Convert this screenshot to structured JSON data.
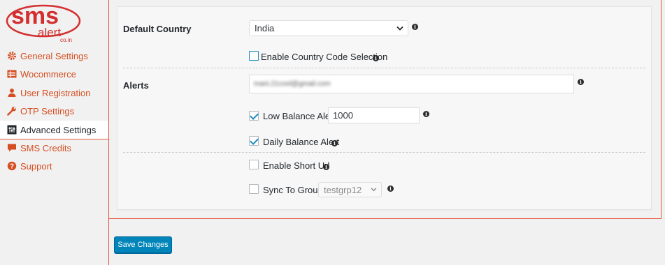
{
  "logo": {
    "top_text": "sms",
    "mid_text": "alert",
    "small_text": "co.in"
  },
  "sidebar": {
    "items": [
      {
        "label": "General Settings",
        "icon": "gear-icon"
      },
      {
        "label": "Wocommerce",
        "icon": "table-icon"
      },
      {
        "label": "User Registration",
        "icon": "user-icon"
      },
      {
        "label": "OTP Settings",
        "icon": "wrench-icon"
      },
      {
        "label": "Advanced Settings",
        "icon": "sliders-icon",
        "active": true
      },
      {
        "label": "SMS Credits",
        "icon": "comment-icon"
      },
      {
        "label": "Support",
        "icon": "question-icon"
      }
    ]
  },
  "form": {
    "default_country": {
      "label": "Default Country",
      "value": "India"
    },
    "enable_country_code": {
      "label": "Enable Country Code Selection",
      "checked": false
    },
    "alerts": {
      "label": "Alerts",
      "email_value": "mani.21cool@gmail.com"
    },
    "low_balance": {
      "label": "Low Balance Alert",
      "checked": true,
      "value": "1000"
    },
    "daily_balance": {
      "label": "Daily Balance Alert",
      "checked": true
    },
    "short_url": {
      "label": "Enable Short Url",
      "checked": false
    },
    "sync_group": {
      "label": "Sync To Group",
      "checked": false,
      "value": "testgrp12"
    },
    "info_glyph": "i"
  },
  "actions": {
    "save_label": "Save Changes"
  },
  "colors": {
    "accent": "#d54e21",
    "border": "#e55a3c",
    "primary_button": "#0085ba"
  }
}
